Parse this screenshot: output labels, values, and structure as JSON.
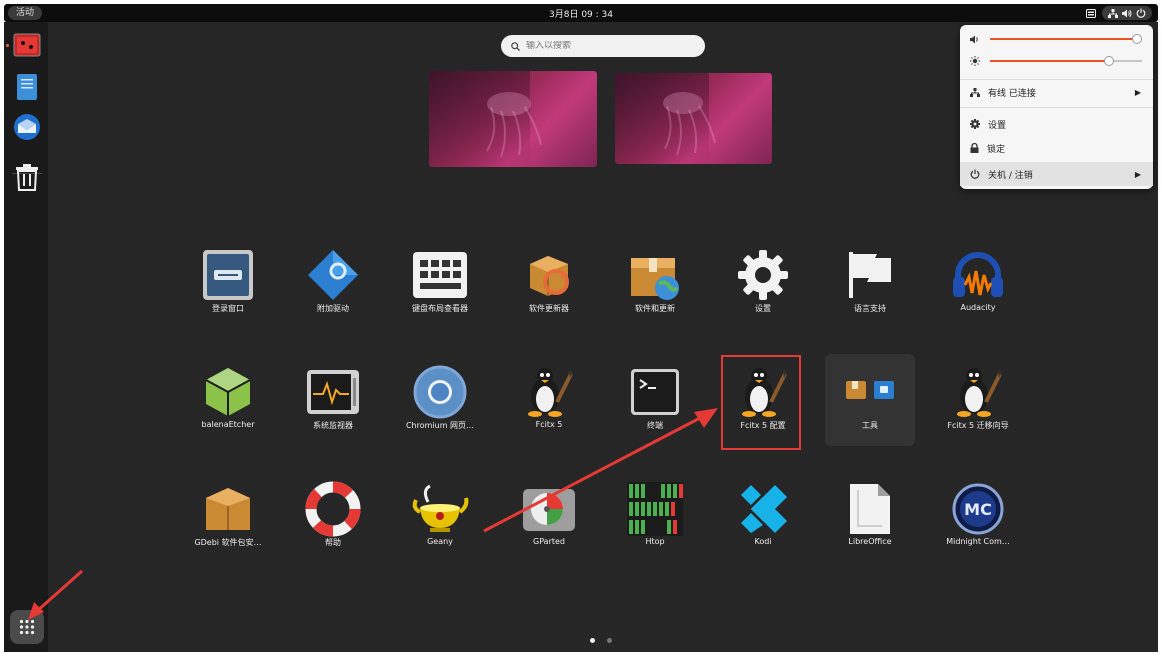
{
  "topbar": {
    "activities": "活动",
    "clock": "3月8日 09 : 34"
  },
  "search": {
    "placeholder": "输入以搜索"
  },
  "apps": [
    {
      "label": "登录窗口",
      "icon": "login-window-icon"
    },
    {
      "label": "附加驱动",
      "icon": "additional-drivers-icon"
    },
    {
      "label": "键盘布局查看器",
      "icon": "keyboard-icon"
    },
    {
      "label": "软件更新器",
      "icon": "software-updater-icon"
    },
    {
      "label": "软件和更新",
      "icon": "software-sources-icon"
    },
    {
      "label": "设置",
      "icon": "gear-icon"
    },
    {
      "label": "语言支持",
      "icon": "flag-icon"
    },
    {
      "label": "Audacity",
      "icon": "headphones-icon"
    },
    {
      "label": "balenaEtcher",
      "icon": "cube-icon"
    },
    {
      "label": "系统监视器",
      "icon": "system-monitor-icon"
    },
    {
      "label": "Chromium 网页…",
      "icon": "chromium-icon"
    },
    {
      "label": "Fcitx 5",
      "icon": "penguin-icon"
    },
    {
      "label": "终端",
      "icon": "terminal-icon"
    },
    {
      "label": "Fcitx 5 配置",
      "icon": "penguin-icon"
    },
    {
      "label": "工具",
      "icon": "folder-icon"
    },
    {
      "label": "Fcitx 5 迁移向导",
      "icon": "penguin-icon"
    },
    {
      "label": "GDebi 软件包安…",
      "icon": "package-icon"
    },
    {
      "label": "帮助",
      "icon": "lifebuoy-icon"
    },
    {
      "label": "Geany",
      "icon": "lamp-icon"
    },
    {
      "label": "GParted",
      "icon": "disk-icon"
    },
    {
      "label": "Htop",
      "icon": "htop-icon"
    },
    {
      "label": "Kodi",
      "icon": "kodi-icon"
    },
    {
      "label": "LibreOffice",
      "icon": "document-icon"
    },
    {
      "label": "Midnight Com…",
      "icon": "mc-icon"
    }
  ],
  "quick_settings": {
    "volume": 0.97,
    "brightness": 0.78,
    "network": "有线 已连接",
    "settings": "设置",
    "lock": "锁定",
    "power": "关机 / 注销"
  },
  "colors": {
    "accent": "#e95420",
    "annotation": "#e53935"
  }
}
